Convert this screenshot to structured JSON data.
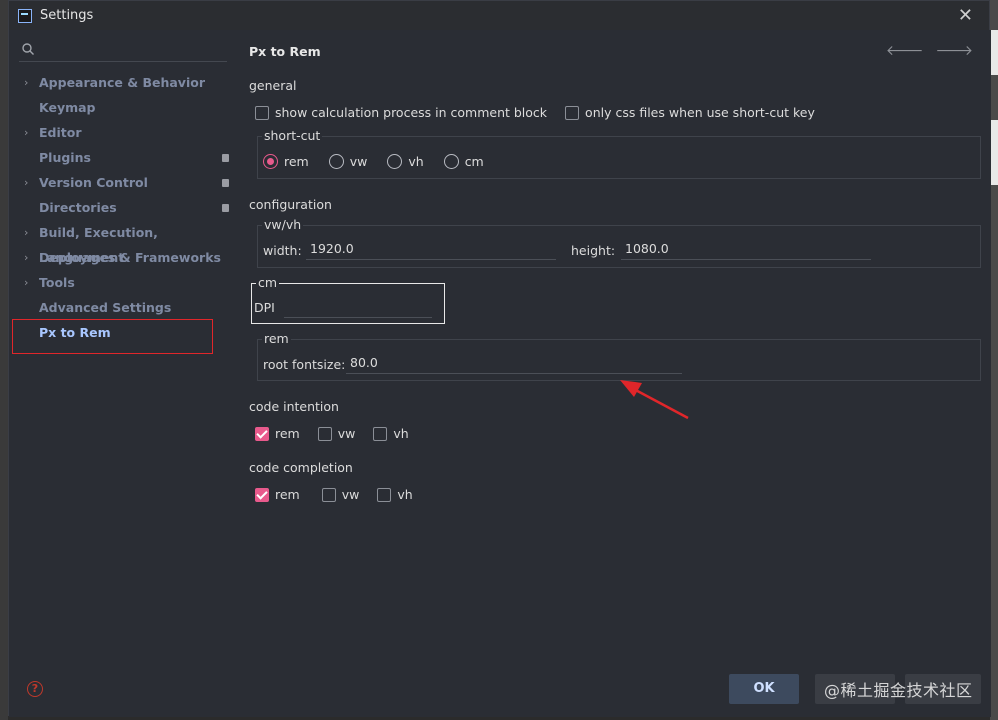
{
  "window": {
    "title": "Settings"
  },
  "sidebar": {
    "search": {
      "placeholder": ""
    },
    "items": [
      {
        "label": "Appearance & Behavior",
        "chevron": true,
        "badge": false
      },
      {
        "label": "Keymap",
        "chevron": false,
        "badge": false
      },
      {
        "label": "Editor",
        "chevron": true,
        "badge": false
      },
      {
        "label": "Plugins",
        "chevron": false,
        "badge": true
      },
      {
        "label": "Version Control",
        "chevron": true,
        "badge": true
      },
      {
        "label": "Directories",
        "chevron": false,
        "badge": true
      },
      {
        "label": "Build, Execution, Deployment",
        "chevron": true,
        "badge": false
      },
      {
        "label": "Languages & Frameworks",
        "chevron": true,
        "badge": false
      },
      {
        "label": "Tools",
        "chevron": true,
        "badge": false
      },
      {
        "label": "Advanced Settings",
        "chevron": false,
        "badge": false
      },
      {
        "label": "Px to Rem",
        "chevron": false,
        "badge": false,
        "selected": true
      }
    ]
  },
  "content": {
    "title": "Px to Rem",
    "general": {
      "label": "general",
      "show_calc": {
        "label": "show calculation process in comment block",
        "checked": false
      },
      "only_css": {
        "label": "only css files when use short-cut key",
        "checked": false
      }
    },
    "shortcut": {
      "label": "short-cut",
      "options": [
        {
          "label": "rem",
          "checked": true
        },
        {
          "label": "vw",
          "checked": false
        },
        {
          "label": "vh",
          "checked": false
        },
        {
          "label": "cm",
          "checked": false
        }
      ]
    },
    "configuration": {
      "label": "configuration",
      "vwvh": {
        "label": "vw/vh",
        "width_label": "width:",
        "width_value": "1920.0",
        "height_label": "height:",
        "height_value": "1080.0"
      },
      "cm": {
        "label": "cm",
        "dpi_label": "DPI",
        "dpi_value": ""
      },
      "rem": {
        "label": "rem",
        "root_label": "root fontsize:",
        "root_value": "80.0"
      }
    },
    "code_intention": {
      "label": "code intention",
      "options": [
        {
          "label": "rem",
          "checked": true
        },
        {
          "label": "vw",
          "checked": false
        },
        {
          "label": "vh",
          "checked": false
        }
      ]
    },
    "code_completion": {
      "label": "code completion",
      "options": [
        {
          "label": "rem",
          "checked": true
        },
        {
          "label": "vw",
          "checked": false
        },
        {
          "label": "vh",
          "checked": false
        }
      ]
    }
  },
  "footer": {
    "ok": "OK",
    "watermark": "@稀土掘金技术社区"
  },
  "colors": {
    "accent": "#e85a8c",
    "selection_frame": "#e0262a",
    "annotation_arrow": "#e0262a"
  }
}
